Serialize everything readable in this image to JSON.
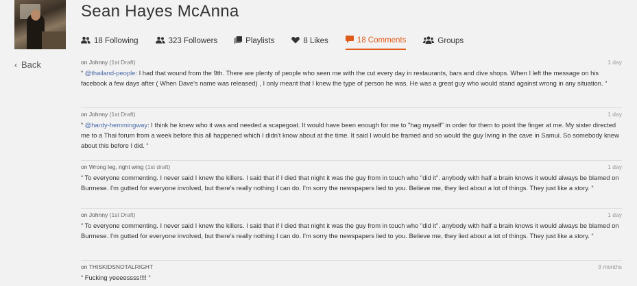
{
  "profile": {
    "name": "Sean Hayes McAnna"
  },
  "nav": {
    "back_label": "Back"
  },
  "tabs": [
    {
      "label": "18 Following",
      "icon": "users-icon"
    },
    {
      "label": "323 Followers",
      "icon": "users-icon"
    },
    {
      "label": "Playlists",
      "icon": "playlist-icon"
    },
    {
      "label": "8 Likes",
      "icon": "heart-icon"
    },
    {
      "label": "18 Comments",
      "icon": "comment-icon",
      "active": true
    },
    {
      "label": "Groups",
      "icon": "group-icon"
    }
  ],
  "accent_color": "#e05a1a",
  "comments": [
    {
      "on": "on",
      "track": "Johnny",
      "version": "(1st Draft)",
      "time": "1 day",
      "open": "“ ",
      "mention": "@thailand-people",
      "body": ": I had that wound from the 9th. There are plenty of people who seen me with the cut every day in restaurants, bars and dive shops. When I left the message on his facebook a few days after ( When Dave's name was released) , I only meant that I knew the type of person he was. He was a great guy who would stand against wrong in any situation. “"
    },
    {
      "on": "on",
      "track": "Johnny",
      "version": "(1st Draft)",
      "time": "1 day",
      "open": "“ ",
      "mention": "@hardy-hemmingway",
      "body": ": I think he knew who it was and needed a scapegoat. It would have been enough for me to \"hag myself\" in order for them to point the finger at me. My sister directed me to a Thai forum from a week before this all happened which I didn't know about at the time. It said I would be framed and so would the guy living in the cave in Samui. So somebody knew about this before I did. “"
    },
    {
      "on": "on",
      "track": "Wrong leg, right wing",
      "version": "(1st draft)",
      "time": "1 day",
      "open": "",
      "mention": "",
      "body": "“ To everyone commenting. I never said I knew the killers. I said that if I died that night it was the guy from in touch who \"did it\". anybody with half a brain knows it would always be blamed on Burmese. I'm gutted for everyone involved, but there's really nothing I can do. I'm sorry the newspapers lied to you. Believe me, they lied about a lot of things. They just like a story. “"
    },
    {
      "on": "on",
      "track": "Johnny",
      "version": "(1st Draft)",
      "time": "1 day",
      "open": "",
      "mention": "",
      "body": "“ To everyone commenting. I never said I knew the killers. I said that if I died that night it was the guy from in touch who \"did it\". anybody with half a brain knows it would always be blamed on Burmese. I'm gutted for everyone involved, but there's really nothing I can do. I'm sorry the newspapers lied to you. Believe me, they lied about a lot of things. They just like a story. “"
    },
    {
      "on": "on",
      "track": "THISKIDSNOTALRIGHT",
      "version": "",
      "time": "3 months",
      "open": "",
      "mention": "",
      "body": "“ Fucking yeeeessss!!!! “"
    }
  ]
}
